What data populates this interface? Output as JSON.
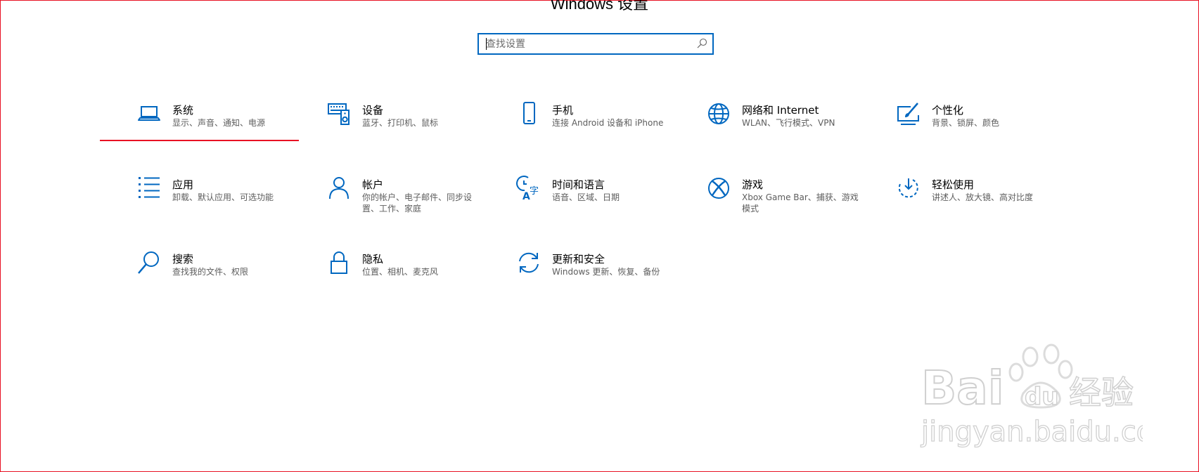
{
  "window": {
    "title": "Windows 设置"
  },
  "search": {
    "placeholder": "查找设置"
  },
  "colors": {
    "accent": "#0067c0",
    "highlight": "#e81123",
    "desc": "#5d5d5d"
  },
  "tiles": [
    {
      "id": "system",
      "name": "系统",
      "desc": "显示、声音、通知、电源",
      "icon": "laptop-icon"
    },
    {
      "id": "devices",
      "name": "设备",
      "desc": "蓝牙、打印机、鼠标",
      "icon": "keyboard-speaker-icon"
    },
    {
      "id": "phone",
      "name": "手机",
      "desc": "连接 Android 设备和 iPhone",
      "icon": "phone-icon"
    },
    {
      "id": "network",
      "name": "网络和 Internet",
      "desc": "WLAN、飞行模式、VPN",
      "icon": "globe-icon"
    },
    {
      "id": "personalization",
      "name": "个性化",
      "desc": "背景、锁屏、颜色",
      "icon": "paint-brush-icon"
    },
    {
      "id": "apps",
      "name": "应用",
      "desc": "卸载、默认应用、可选功能",
      "icon": "app-list-icon"
    },
    {
      "id": "accounts",
      "name": "帐户",
      "desc": "你的帐户、电子邮件、同步设置、工作、家庭",
      "icon": "person-icon"
    },
    {
      "id": "time-language",
      "name": "时间和语言",
      "desc": "语音、区域、日期",
      "icon": "time-language-icon"
    },
    {
      "id": "gaming",
      "name": "游戏",
      "desc": "Xbox Game Bar、捕获、游戏模式",
      "icon": "xbox-icon"
    },
    {
      "id": "ease-of-access",
      "name": "轻松使用",
      "desc": "讲述人、放大镜、高对比度",
      "icon": "ease-of-access-icon"
    },
    {
      "id": "search",
      "name": "搜索",
      "desc": "查找我的文件、权限",
      "icon": "magnifier-icon"
    },
    {
      "id": "privacy",
      "name": "隐私",
      "desc": "位置、相机、麦克风",
      "icon": "lock-icon"
    },
    {
      "id": "update-security",
      "name": "更新和安全",
      "desc": "Windows 更新、恢复、备份",
      "icon": "refresh-icon"
    }
  ],
  "watermark": {
    "brand": "Bai",
    "brand2": "du",
    "brand_cn": "经验",
    "url": "jingyan.baidu.com"
  }
}
